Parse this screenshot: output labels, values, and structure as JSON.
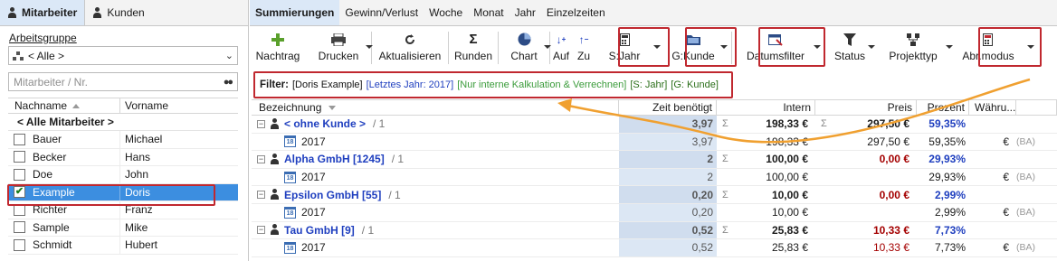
{
  "left": {
    "tabs": [
      {
        "label": "Mitarbeiter",
        "icon": "person-icon",
        "active": true
      },
      {
        "label": "Kunden",
        "icon": "person-icon",
        "active": false
      }
    ],
    "group_label": "Arbeitsgruppe",
    "group_value": "< Alle >",
    "search_placeholder": "Mitarbeiter / Nr.",
    "columns": {
      "lastname": "Nachname",
      "firstname": "Vorname"
    },
    "all_label": "< Alle Mitarbeiter >",
    "employees": [
      {
        "last": "Bauer",
        "first": "Michael",
        "checked": false
      },
      {
        "last": "Becker",
        "first": "Hans",
        "checked": false
      },
      {
        "last": "Doe",
        "first": "John",
        "checked": false
      },
      {
        "last": "Example",
        "first": "Doris",
        "checked": true
      },
      {
        "last": "Richter",
        "first": "Franz",
        "checked": false
      },
      {
        "last": "Sample",
        "first": "Mike",
        "checked": false
      },
      {
        "last": "Schmidt",
        "first": "Hubert",
        "checked": false
      }
    ]
  },
  "tabs": [
    "Summierungen",
    "Gewinn/Verlust",
    "Woche",
    "Monat",
    "Jahr",
    "Einzelzeiten"
  ],
  "toolbar": {
    "nachtrag": "Nachtrag",
    "drucken": "Drucken",
    "aktualisieren": "Aktualisieren",
    "runden": "Runden",
    "chart": "Chart",
    "auf": "Auf",
    "zu": "Zu",
    "sjahr": "S:Jahr",
    "gkunde": "G:Kunde",
    "datumsfilter": "Datumsfilter",
    "status": "Status",
    "projekttyp": "Projekttyp",
    "abrmodus": "Abr.modus"
  },
  "filter": {
    "label": "Filter:",
    "employee": "[Doris Example]",
    "period": "[Letztes Jahr: 2017]",
    "calc": "[Nur interne Kalkulation & Verrechnen]",
    "sum_by": "[S: Jahr]",
    "group_by": "[G: Kunde]"
  },
  "grid": {
    "headers": {
      "name": "Bezeichnung",
      "zeit": "Zeit benötigt",
      "intern": "Intern",
      "preis": "Preis",
      "prozent": "Prozent",
      "waehrung": "Währu..."
    },
    "rows": [
      {
        "type": "group",
        "name": "< ohne Kunde >",
        "count": "/ 1",
        "zeit": "3,97",
        "intern": "198,33 €",
        "preis": "297,50 €",
        "prozent": "59,35%",
        "preis_red": false
      },
      {
        "type": "year",
        "name": "2017",
        "zeit": "3,97",
        "intern": "198,33 €",
        "preis": "297,50 €",
        "prozent": "59,35%",
        "currency": "€",
        "ba": "(BA)",
        "preis_red": false
      },
      {
        "type": "group",
        "name": "Alpha GmbH [1245]",
        "count": "/ 1",
        "zeit": "2",
        "intern": "100,00 €",
        "preis": "0,00 €",
        "prozent": "29,93%",
        "preis_red": true
      },
      {
        "type": "year",
        "name": "2017",
        "zeit": "2",
        "intern": "100,00 €",
        "preis": "",
        "prozent": "29,93%",
        "currency": "€",
        "ba": "(BA)",
        "preis_red": false
      },
      {
        "type": "group",
        "name": "Epsilon GmbH [55]",
        "count": "/ 1",
        "zeit": "0,20",
        "intern": "10,00 €",
        "preis": "0,00 €",
        "prozent": "2,99%",
        "preis_red": true
      },
      {
        "type": "year",
        "name": "2017",
        "zeit": "0,20",
        "intern": "10,00 €",
        "preis": "",
        "prozent": "2,99%",
        "currency": "€",
        "ba": "(BA)",
        "preis_red": false
      },
      {
        "type": "group",
        "name": "Tau GmbH [9]",
        "count": "/ 1",
        "zeit": "0,52",
        "intern": "25,83 €",
        "preis": "10,33 €",
        "prozent": "7,73%",
        "preis_red": true
      },
      {
        "type": "year",
        "name": "2017",
        "zeit": "0,52",
        "intern": "25,83 €",
        "preis": "10,33 €",
        "prozent": "7,73%",
        "currency": "€",
        "ba": "(BA)",
        "preis_red": true
      }
    ]
  },
  "colors": {
    "accent_red": "#c0282f",
    "selection": "#3c8ee0",
    "arrow": "#f0a030",
    "blue_text": "#1f3fbf"
  }
}
